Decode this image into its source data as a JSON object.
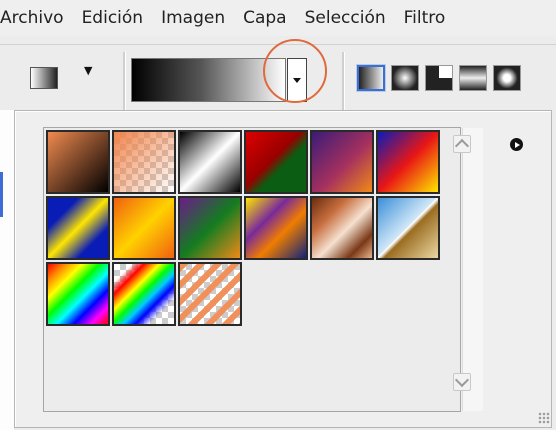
{
  "menubar": {
    "items": [
      "Archivo",
      "Edición",
      "Imagen",
      "Capa",
      "Selección",
      "Filtro"
    ]
  },
  "options_bar": {
    "tool_preset": "gradient-tool-preset-icon",
    "current_gradient": "black-to-white",
    "gradient_types": [
      "linear",
      "radial",
      "angle",
      "reflected",
      "diamond"
    ],
    "selected_type": "linear"
  },
  "picker": {
    "menu_icon": "picker-menu-arrow-icon",
    "swatches": [
      {
        "id": "orange-to-black"
      },
      {
        "id": "orange-to-transparent"
      },
      {
        "id": "black-white"
      },
      {
        "id": "red-green"
      },
      {
        "id": "violet-orange"
      },
      {
        "id": "blue-red-yellow"
      },
      {
        "id": "blue-yellow-blue"
      },
      {
        "id": "orange-yellow-orange"
      },
      {
        "id": "violet-green-orange"
      },
      {
        "id": "yellow-violet-orange-blue"
      },
      {
        "id": "copper"
      },
      {
        "id": "chrome"
      },
      {
        "id": "spectrum"
      },
      {
        "id": "transparent-rainbow"
      },
      {
        "id": "transparent-stripes"
      }
    ]
  },
  "colors": {
    "highlight_circle": "#e06a3c",
    "selected_outline": "#3a6fd8"
  }
}
